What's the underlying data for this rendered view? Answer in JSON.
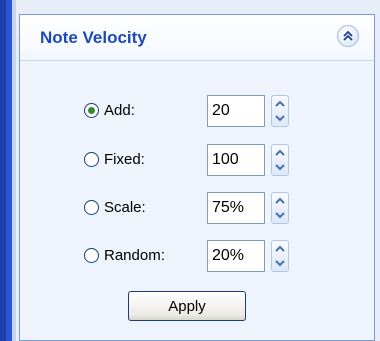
{
  "panel": {
    "title": "Note Velocity",
    "collapse_icon": "double-chevron-up-icon"
  },
  "options": [
    {
      "label": "Add:",
      "value": "20",
      "selected": true
    },
    {
      "label": "Fixed:",
      "value": "100",
      "selected": false
    },
    {
      "label": "Scale:",
      "value": "75%",
      "selected": false
    },
    {
      "label": "Random:",
      "value": "20%",
      "selected": false
    }
  ],
  "apply_label": "Apply",
  "colors": {
    "title": "#1c4ab8",
    "frame": "#1e3fae",
    "panel_bg": "#eef3fc",
    "radio_dot": "#2e8b2e"
  }
}
